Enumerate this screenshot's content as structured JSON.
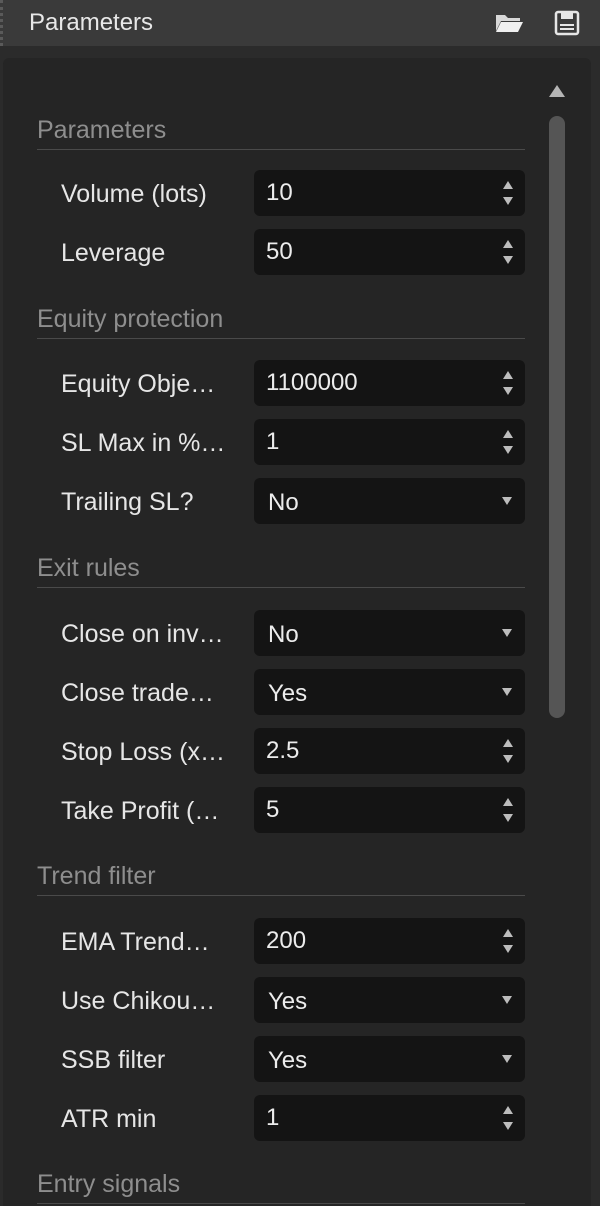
{
  "header": {
    "title": "Parameters"
  },
  "sections": [
    {
      "title": "Parameters"
    },
    {
      "title": "Equity protection"
    },
    {
      "title": "Exit rules"
    },
    {
      "title": "Trend filter"
    },
    {
      "title": "Entry signals"
    }
  ],
  "rows": [
    {
      "label": "Volume (lots)",
      "value": "10",
      "kind": "number"
    },
    {
      "label": "Leverage",
      "value": "50",
      "kind": "number"
    },
    {
      "label": "Equity Obje…",
      "value": "1100000",
      "kind": "number"
    },
    {
      "label": "SL Max in %…",
      "value": "1",
      "kind": "number"
    },
    {
      "label": "Trailing SL?",
      "value": "No",
      "kind": "select"
    },
    {
      "label": "Close on inv…",
      "value": "No",
      "kind": "select"
    },
    {
      "label": "Close trade…",
      "value": "Yes",
      "kind": "select"
    },
    {
      "label": "Stop Loss (x…",
      "value": "2.5",
      "kind": "number"
    },
    {
      "label": "Take Profit (…",
      "value": "5",
      "kind": "number"
    },
    {
      "label": "EMA Trend…",
      "value": "200",
      "kind": "number"
    },
    {
      "label": "Use Chikou…",
      "value": "Yes",
      "kind": "select"
    },
    {
      "label": "SSB filter",
      "value": "Yes",
      "kind": "select"
    },
    {
      "label": "ATR min",
      "value": "1",
      "kind": "number"
    }
  ],
  "icons": {
    "open": "folder-open-icon",
    "save": "save-icon",
    "spin_up": "spin-up-icon",
    "spin_down": "spin-down-icon",
    "dropdown": "chevron-down-icon",
    "scroll_up": "scroll-up-arrow-icon"
  }
}
